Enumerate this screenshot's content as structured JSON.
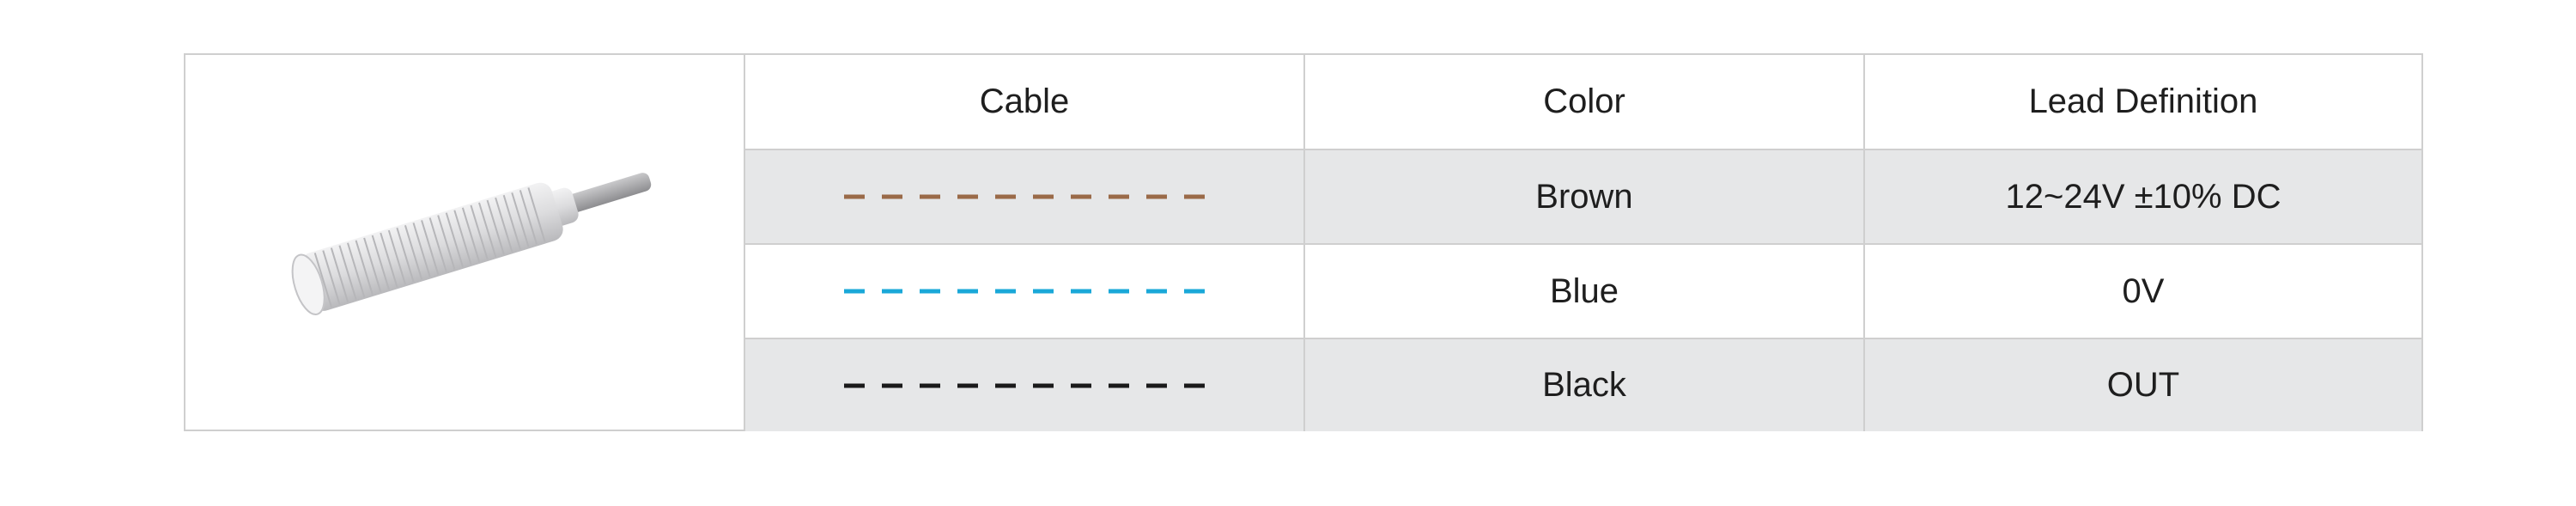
{
  "header": {
    "cable": "Cable",
    "color": "Color",
    "lead_definition": "Lead Definition"
  },
  "rows": [
    {
      "color": "Brown",
      "lead": "12~24V ±10% DC",
      "line_color": "#9a6a48",
      "shaded": true
    },
    {
      "color": "Blue",
      "lead": "0V",
      "line_color": "#1aa8d8",
      "shaded": false
    },
    {
      "color": "Black",
      "lead": "OUT",
      "line_color": "#1a1a1a",
      "shaded": true
    }
  ],
  "product": {
    "icon": "cylindrical-sensor-icon"
  }
}
